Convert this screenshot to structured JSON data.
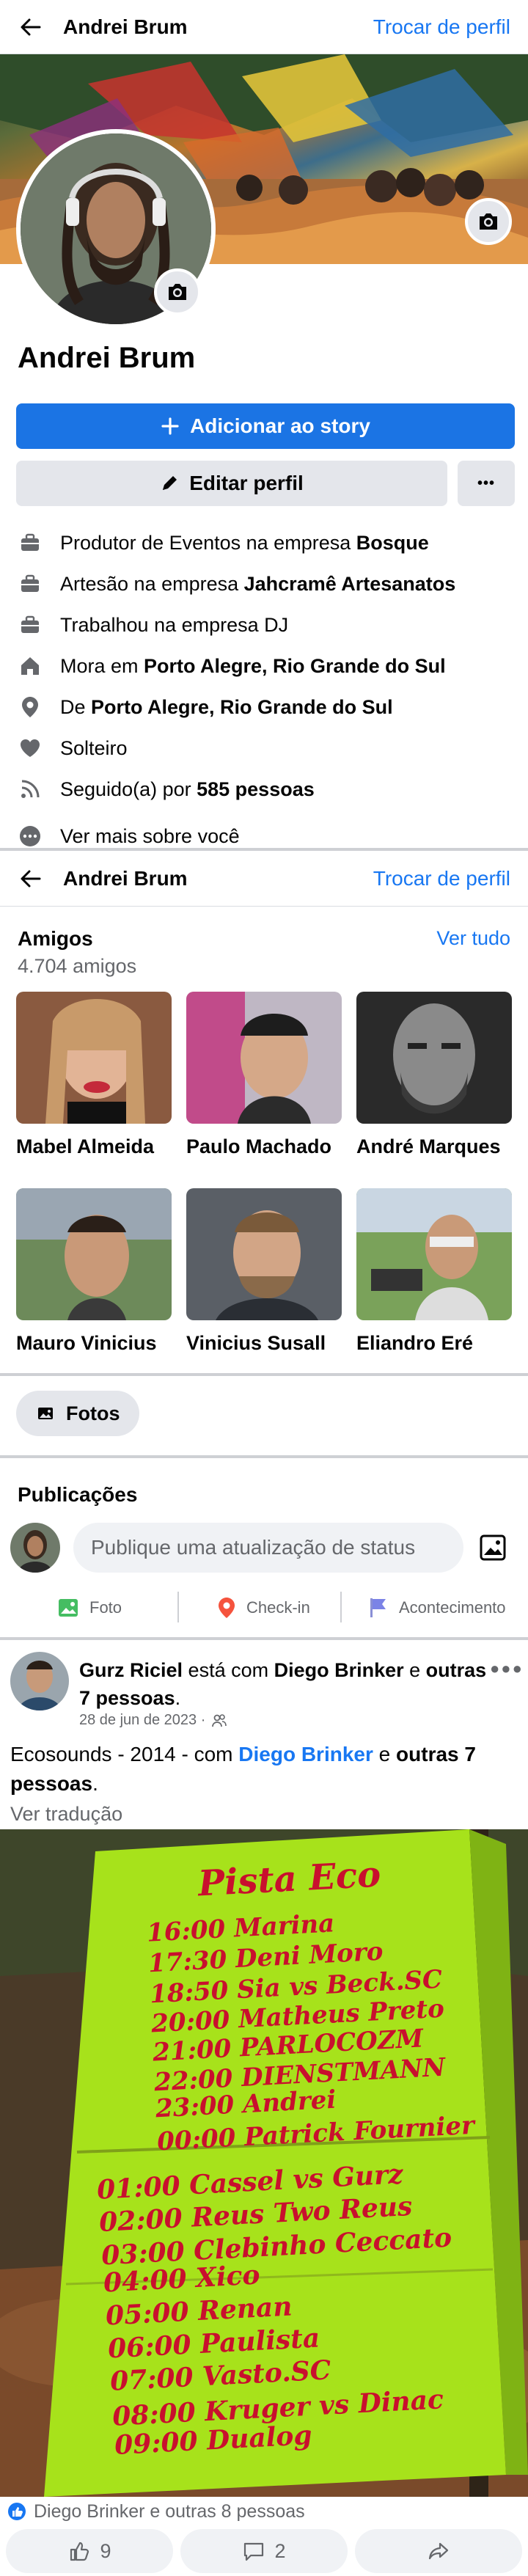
{
  "header": {
    "name": "Andrei Brum",
    "switch_profile": "Trocar de perfil"
  },
  "profile": {
    "name": "Andrei Brum",
    "add_story": "Adicionar ao story",
    "edit_profile": "Editar perfil",
    "more": "•••"
  },
  "details": [
    {
      "icon": "briefcase-icon",
      "prefix": "Produtor de Eventos na empresa ",
      "bold": "Bosque"
    },
    {
      "icon": "briefcase-icon",
      "prefix": "Artesão na empresa ",
      "bold": "Jahcramê Artesanatos"
    },
    {
      "icon": "briefcase-icon",
      "prefix": "Trabalhou na empresa DJ",
      "bold": ""
    },
    {
      "icon": "home-icon",
      "prefix": "Mora em ",
      "bold": "Porto Alegre, Rio Grande do Sul"
    },
    {
      "icon": "location-pin-icon",
      "prefix": "De ",
      "bold": "Porto Alegre, Rio Grande do Sul"
    },
    {
      "icon": "heart-icon",
      "prefix": "Solteiro",
      "bold": ""
    },
    {
      "icon": "rss-icon",
      "prefix": "Seguido(a) por ",
      "bold": "585 pessoas"
    },
    {
      "icon": "more-dots-icon",
      "prefix": "Ver mais sobre você",
      "bold": ""
    }
  ],
  "friends": {
    "title": "Amigos",
    "count": "4.704 amigos",
    "see_all": "Ver tudo",
    "list": [
      {
        "name": "Mabel Almeida"
      },
      {
        "name": "Paulo Machado"
      },
      {
        "name": "André Marques"
      },
      {
        "name": "Mauro Vinicius"
      },
      {
        "name": "Vinicius Susall"
      },
      {
        "name": "Eliandro Eré"
      }
    ]
  },
  "photos_chip": "Fotos",
  "publications": {
    "title": "Publicações",
    "status_placeholder": "Publique uma atualização de status",
    "actions": [
      "Foto",
      "Check-in",
      "Acontecimento"
    ]
  },
  "post": {
    "author": "Gurz Riciel",
    "with_text": " está com ",
    "tagged": "Diego Brinker",
    "and_text": " e ",
    "others": "outras 7 pessoas",
    "period": ".",
    "date": "28 de jun de 2023 ·",
    "body_prefix": "Ecosounds - 2014 - com ",
    "body_link": "Diego Brinker",
    "body_and": " e ",
    "body_others": "outras 7 pessoas",
    "body_end": ".",
    "translate": "Ver tradução",
    "sign": {
      "title": "Pista Eco",
      "lines_top": [
        "16:00 Marina",
        "17:30 Deni Moro",
        "18:50 Sia vs Beck.SC",
        "20:00 Matheus Preto",
        "21:00 PARLOCOZM",
        "22:00 DIENSTMANN",
        "23:00 Andrei",
        "00:00 Patrick Fournier"
      ],
      "lines_bottom": [
        "01:00 Cassel vs Gurz",
        "02:00 Reus Two Reus",
        "03:00 Clebinho Ceccato",
        "04:00 Xico",
        "05:00 Renan",
        "06:00 Paulista",
        "07:00 Vasto.SC",
        "08:00 Kruger vs Dinac",
        "09:00 Dualog"
      ]
    },
    "reactions_text": "Diego Brinker e outras 8 pessoas",
    "likes": "9",
    "comments": "2"
  }
}
